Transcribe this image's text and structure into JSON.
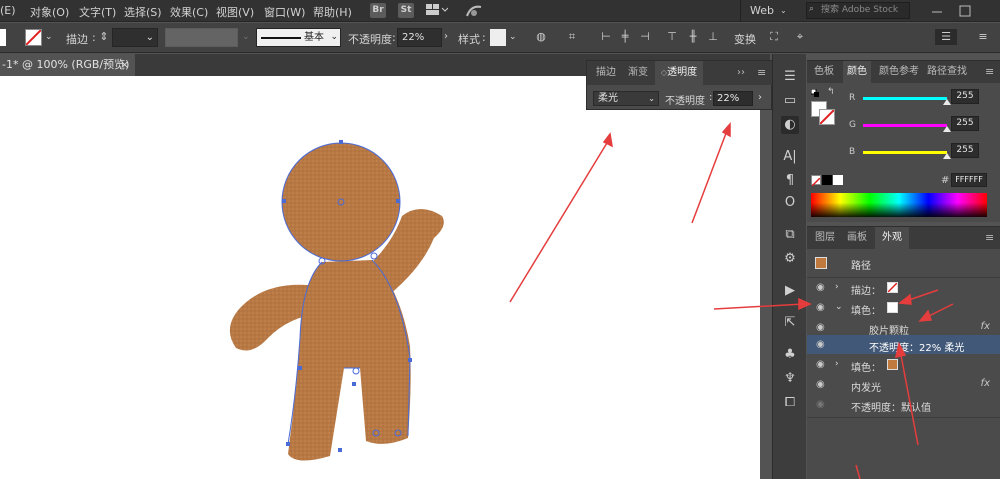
{
  "menu": {
    "items": [
      "(E)",
      "对象(O)",
      "文字(T)",
      "选择(S)",
      "效果(C)",
      "视图(V)",
      "窗口(W)",
      "帮助(H)"
    ],
    "app_br": "Br",
    "app_st": "St",
    "workspace": "Web",
    "search_placeholder": "搜索 Adobe Stock"
  },
  "control": {
    "stroke_label": "描边",
    "profile_label": "基本",
    "opacity_label": "不透明度",
    "opacity_value": "22%",
    "style_label": "样式",
    "transform_label": "变换"
  },
  "document": {
    "tab_title": "-1* @ 100% (RGB/预览)",
    "close": "×"
  },
  "transparency_panel": {
    "tabs": [
      "描边",
      "渐变",
      "透明度"
    ],
    "active_tab": "透明度",
    "blend_mode": "柔光",
    "opacity_label": "不透明度",
    "opacity_value": "22%"
  },
  "color_panel": {
    "tabs": [
      "色板",
      "颜色",
      "颜色参考",
      "路径查找"
    ],
    "active_tab": "颜色",
    "channels": [
      {
        "label": "R",
        "value": "255",
        "gradient": "#00ffff",
        "level": 1.0
      },
      {
        "label": "G",
        "value": "255",
        "gradient": "#ff00ff",
        "level": 1.0
      },
      {
        "label": "B",
        "value": "255",
        "gradient": "#ffff00",
        "level": 1.0
      }
    ],
    "hash": "#",
    "hex": "FFFFFF"
  },
  "appearance_panel": {
    "tabs": [
      "图层",
      "画板",
      "外观"
    ],
    "active_tab": "外观",
    "header": "路径",
    "object_color": "#c07a3e",
    "rows": [
      {
        "label": "描边：",
        "type": "stroke"
      },
      {
        "label": "填色：",
        "type": "fill-white"
      },
      {
        "label": "胶片颗粒",
        "type": "effect",
        "fx": "fx"
      },
      {
        "label": "不透明度：22% 柔光",
        "type": "opacity-selected"
      },
      {
        "label": "填色：",
        "type": "fill-brown"
      },
      {
        "label": "内发光",
        "type": "effect",
        "fx": "fx"
      },
      {
        "label": "不透明度：",
        "value": "默认值",
        "type": "opacity"
      }
    ]
  },
  "colors": {
    "fill_brown": "#b97a45",
    "annotation": "#e53d3d",
    "selection": "#4a6bd6"
  }
}
